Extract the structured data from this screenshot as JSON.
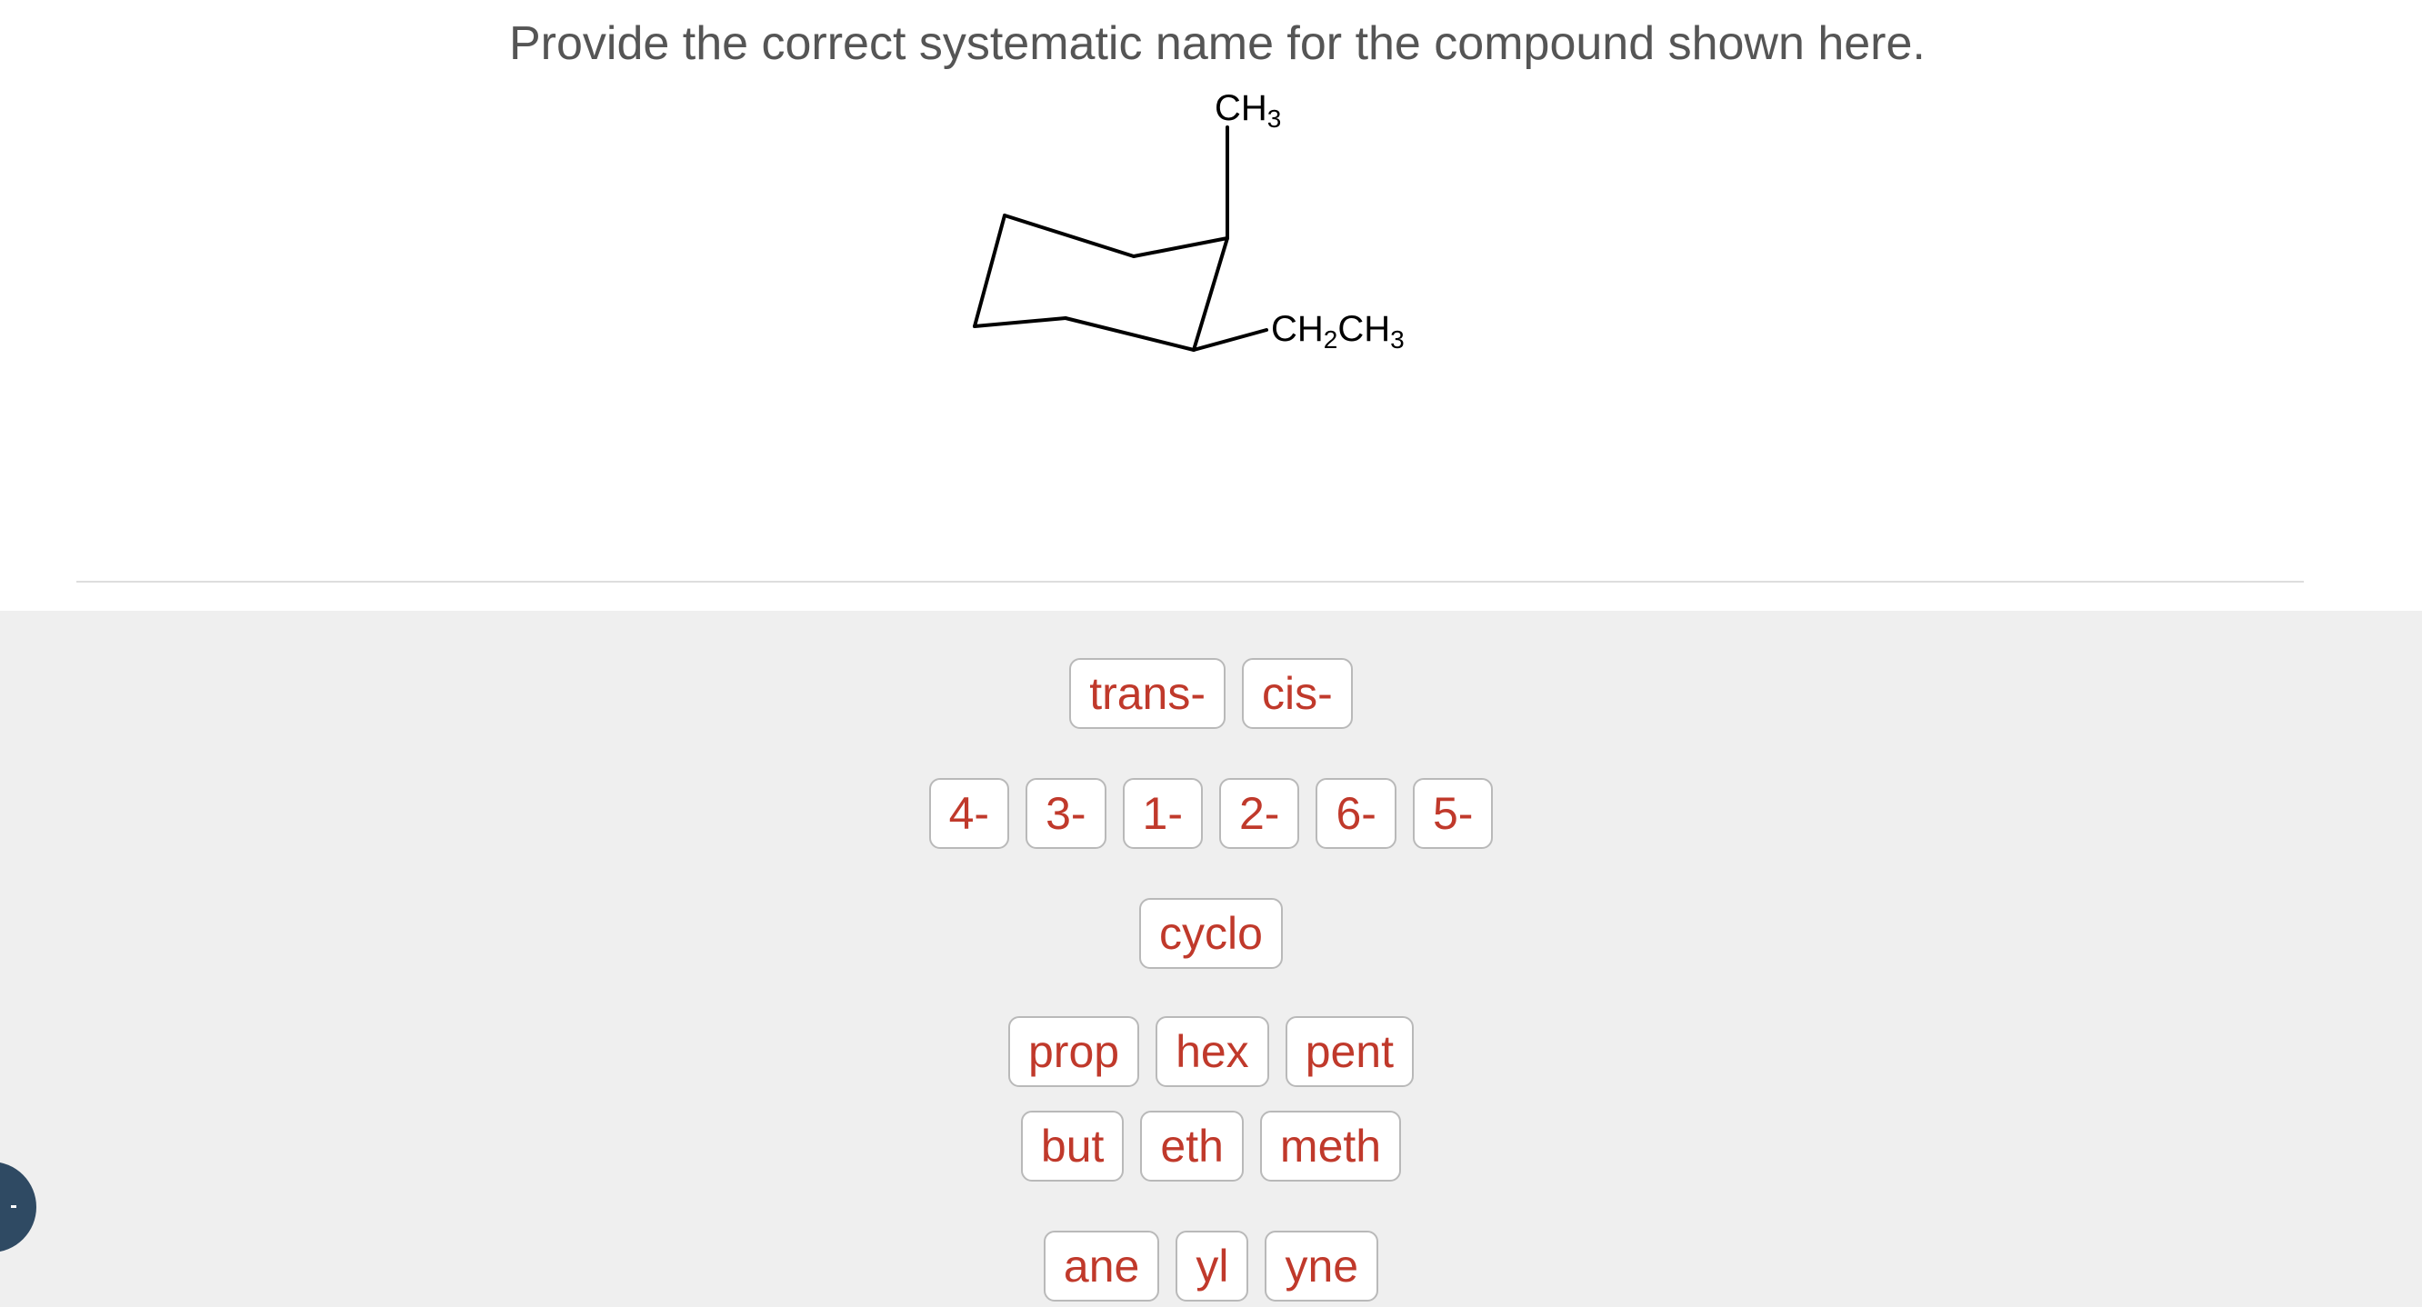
{
  "question": {
    "text": "Provide the correct systematic name for the compound shown here."
  },
  "structure": {
    "substituent_top": "CH3",
    "substituent_right": "CH2CH3"
  },
  "tiles": {
    "stereo": [
      "trans-",
      "cis-"
    ],
    "locants": [
      "4-",
      "3-",
      "1-",
      "2-",
      "6-",
      "5-"
    ],
    "ring": [
      "cyclo"
    ],
    "roots_row1": [
      "prop",
      "hex",
      "pent"
    ],
    "roots_row2": [
      "but",
      "eth",
      "meth"
    ],
    "suffixes": [
      "ane",
      "yl",
      "yne"
    ]
  },
  "colors": {
    "tile_text": "#c0392b",
    "tray_background": "#efefef",
    "side_tab": "#2f4a63"
  }
}
